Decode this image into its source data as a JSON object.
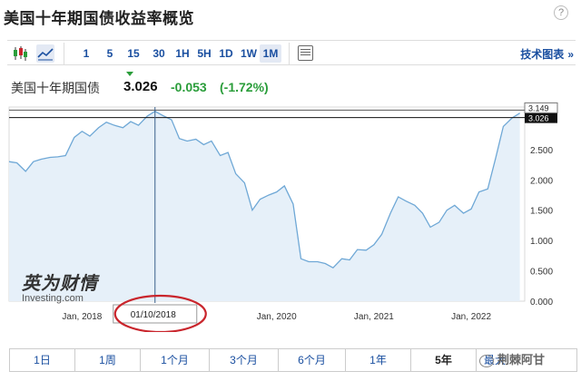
{
  "header": {
    "title": "美国十年期国债收益率概览",
    "help_glyph": "?"
  },
  "toolbar": {
    "chart_types": [
      {
        "name": "candlestick-icon"
      },
      {
        "name": "area-chart-icon"
      }
    ],
    "ranges": [
      "1",
      "5",
      "15",
      "30",
      "1H",
      "5H",
      "1D",
      "1W",
      "1M"
    ],
    "active_range": "1M",
    "tech_chart_label": "技术图表",
    "tech_chart_arrow": "»"
  },
  "quote": {
    "name": "美国十年期国债",
    "price": "3.026",
    "change": "-0.053",
    "change_pct": "(-1.72%)"
  },
  "watermark": {
    "brand_cn": "英为财情",
    "brand_en": "Investing.com"
  },
  "bottom_ranges": [
    "1日",
    "1周",
    "1个月",
    "3个月",
    "6个月",
    "1年",
    "5年",
    "最大"
  ],
  "active_bottom_range": "5年",
  "wechat": {
    "label": "荆棘阿甘"
  },
  "colors": {
    "line": "#6fa8d6",
    "fill": "#e6f0f9",
    "positive": "#2a9d3a",
    "link": "#1a4fa0",
    "circle": "#c9252c"
  },
  "chart_data": {
    "type": "area",
    "ylim": [
      0,
      3.2
    ],
    "yticks": [
      "0.000",
      "0.500",
      "1.000",
      "1.500",
      "2.000",
      "2.500"
    ],
    "x_labels": [
      {
        "label": "Jan, 2018",
        "x": 2018.0
      },
      {
        "label": "Jan, 2020",
        "x": 2020.0
      },
      {
        "label": "Jan, 2021",
        "x": 2021.0
      },
      {
        "label": "Jan, 2022",
        "x": 2022.0
      }
    ],
    "xlim": [
      2017.25,
      2022.55
    ],
    "series": [
      {
        "values": [
          [
            2017.25,
            2.3
          ],
          [
            2017.33,
            2.28
          ],
          [
            2017.42,
            2.14
          ],
          [
            2017.5,
            2.3
          ],
          [
            2017.58,
            2.34
          ],
          [
            2017.67,
            2.37
          ],
          [
            2017.75,
            2.38
          ],
          [
            2017.83,
            2.4
          ],
          [
            2017.92,
            2.7
          ],
          [
            2018.0,
            2.8
          ],
          [
            2018.08,
            2.72
          ],
          [
            2018.17,
            2.86
          ],
          [
            2018.25,
            2.95
          ],
          [
            2018.33,
            2.9
          ],
          [
            2018.42,
            2.86
          ],
          [
            2018.5,
            2.96
          ],
          [
            2018.58,
            2.9
          ],
          [
            2018.67,
            3.05
          ],
          [
            2018.75,
            3.13
          ],
          [
            2018.83,
            3.06
          ],
          [
            2018.92,
            2.99
          ],
          [
            2019.0,
            2.68
          ],
          [
            2019.08,
            2.64
          ],
          [
            2019.17,
            2.67
          ],
          [
            2019.25,
            2.58
          ],
          [
            2019.33,
            2.64
          ],
          [
            2019.42,
            2.4
          ],
          [
            2019.5,
            2.45
          ],
          [
            2019.58,
            2.1
          ],
          [
            2019.67,
            1.95
          ],
          [
            2019.75,
            1.5
          ],
          [
            2019.83,
            1.68
          ],
          [
            2019.92,
            1.75
          ],
          [
            2020.0,
            1.8
          ],
          [
            2020.08,
            1.9
          ],
          [
            2020.17,
            1.6
          ],
          [
            2020.25,
            0.7
          ],
          [
            2020.33,
            0.65
          ],
          [
            2020.42,
            0.65
          ],
          [
            2020.5,
            0.62
          ],
          [
            2020.58,
            0.55
          ],
          [
            2020.67,
            0.7
          ],
          [
            2020.75,
            0.68
          ],
          [
            2020.83,
            0.85
          ],
          [
            2020.92,
            0.84
          ],
          [
            2021.0,
            0.93
          ],
          [
            2021.08,
            1.1
          ],
          [
            2021.17,
            1.45
          ],
          [
            2021.25,
            1.72
          ],
          [
            2021.33,
            1.65
          ],
          [
            2021.42,
            1.58
          ],
          [
            2021.5,
            1.45
          ],
          [
            2021.58,
            1.22
          ],
          [
            2021.67,
            1.3
          ],
          [
            2021.75,
            1.5
          ],
          [
            2021.83,
            1.58
          ],
          [
            2021.92,
            1.45
          ],
          [
            2022.0,
            1.52
          ],
          [
            2022.08,
            1.8
          ],
          [
            2022.17,
            1.85
          ],
          [
            2022.25,
            2.35
          ],
          [
            2022.33,
            2.88
          ],
          [
            2022.42,
            3.02
          ],
          [
            2022.5,
            3.1
          ]
        ]
      }
    ],
    "crosshair": {
      "date": "01/10/2018",
      "x": 2018.75,
      "value": "3.149"
    },
    "current": {
      "label": "3.026",
      "value": 3.026
    }
  }
}
